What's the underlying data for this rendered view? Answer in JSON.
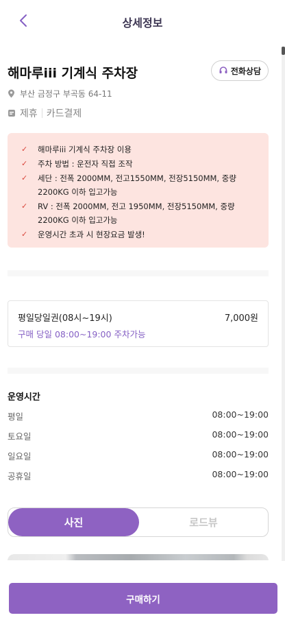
{
  "header": {
    "title": "상세정보",
    "back_icon": "chevron-left-icon"
  },
  "lot": {
    "name": "해마루iii 기계식 주차장",
    "call_label": "전화상담",
    "address": "부산 금정구 부곡동 64-11",
    "tags": [
      "제휴",
      "카드결제"
    ]
  },
  "notice": [
    "해마루iii 기계식 주차장 이용",
    "주차 방법 : 운전자 직접 조작",
    "세단 : 전폭 2000MM, 전고1550MM, 전장5150MM, 중량 2200KG 이하 입고가능",
    "RV : 전폭 2000MM, 전고 1950MM, 전장5150MM, 중량 2200KG 이하 입고가능",
    "운영시간 초과 시 현장요금 발생!"
  ],
  "ticket": {
    "name": "평일당일권(08시~19시)",
    "price": "7,000원",
    "availability": "구매 당일 08:00~19:00 주차가능"
  },
  "hours": {
    "title": "운영시간",
    "rows": [
      {
        "day": "평일",
        "time": "08:00~19:00"
      },
      {
        "day": "토요일",
        "time": "08:00~19:00"
      },
      {
        "day": "일요일",
        "time": "08:00~19:00"
      },
      {
        "day": "공휴일",
        "time": "08:00~19:00"
      }
    ]
  },
  "tabs": {
    "photo": "사진",
    "roadview": "로드뷰",
    "active": "사진"
  },
  "buy_button": "구매하기",
  "colors": {
    "accent": "#8e62c2",
    "notice_bg": "#fde4e0",
    "check": "#d9453a"
  }
}
